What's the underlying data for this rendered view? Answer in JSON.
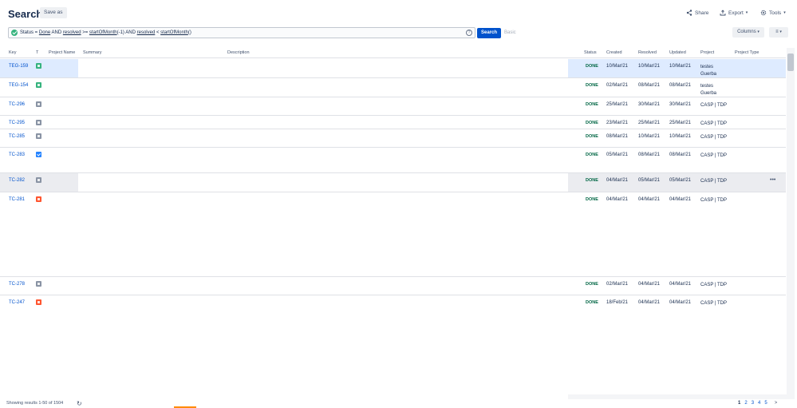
{
  "header": {
    "title": "Search",
    "save_as": "Save as",
    "share": "Share",
    "export": "Export",
    "tools": "Tools"
  },
  "query": {
    "p1": "Status = ",
    "status": "Done",
    "p2": " AND ",
    "resolved1": "resolved",
    "p3": " >= ",
    "fn1": "startOfMonth",
    "p4": "(-1) AND ",
    "resolved2": "resolved",
    "p5": " < ",
    "fn2": "startOfMonth",
    "p6": "()",
    "help": "?",
    "search_label": "Search",
    "basic_label": "Basic"
  },
  "toolbar": {
    "columns": "Columns",
    "menu": "≡"
  },
  "columns": {
    "key": "Key",
    "t": "T",
    "project_name": "Project Name",
    "summary": "Summary",
    "description": "Description",
    "status": "Status",
    "created": "Created",
    "resolved": "Resolved",
    "updated": "Updated",
    "project": "Project",
    "project_type": "Project Type"
  },
  "rows": [
    {
      "key": "TEG-159",
      "type": "story-icon",
      "status": "DONE",
      "created": "10/Mar/21",
      "resolved": "10/Mar/21",
      "updated": "10/Mar/21",
      "project": "testes Guerba"
    },
    {
      "key": "TEG-154",
      "type": "story-icon",
      "status": "DONE",
      "created": "02/Mar/21",
      "resolved": "08/Mar/21",
      "updated": "08/Mar/21",
      "project": "testes Guerba"
    },
    {
      "key": "TC-296",
      "type": "task-icon",
      "status": "DONE",
      "created": "25/Mar/21",
      "resolved": "30/Mar/21",
      "updated": "30/Mar/21",
      "project": "CASP | TDP"
    },
    {
      "key": "TC-295",
      "type": "task-icon",
      "status": "DONE",
      "created": "23/Mar/21",
      "resolved": "25/Mar/21",
      "updated": "25/Mar/21",
      "project": "CASP | TDP"
    },
    {
      "key": "TC-285",
      "type": "task-icon",
      "status": "DONE",
      "created": "08/Mar/21",
      "resolved": "10/Mar/21",
      "updated": "10/Mar/21",
      "project": "CASP | TDP"
    },
    {
      "key": "TC-283",
      "type": "check-icon",
      "status": "DONE",
      "created": "05/Mar/21",
      "resolved": "08/Mar/21",
      "updated": "08/Mar/21",
      "project": "CASP | TDP"
    },
    {
      "key": "TC-282",
      "type": "task-icon",
      "status": "DONE",
      "created": "04/Mar/21",
      "resolved": "05/Mar/21",
      "updated": "05/Mar/21",
      "project": "CASP | TDP",
      "more": "•••"
    },
    {
      "key": "TC-281",
      "type": "bug-icon",
      "status": "DONE",
      "created": "04/Mar/21",
      "resolved": "04/Mar/21",
      "updated": "04/Mar/21",
      "project": "CASP | TDP"
    },
    {
      "key": "TC-278",
      "type": "task-icon",
      "status": "DONE",
      "created": "02/Mar/21",
      "resolved": "04/Mar/21",
      "updated": "04/Mar/21",
      "project": "CASP | TDP"
    },
    {
      "key": "TC-247",
      "type": "bug-icon",
      "status": "DONE",
      "created": "18/Feb/21",
      "resolved": "04/Mar/21",
      "updated": "04/Mar/21",
      "project": "CASP | TDP"
    }
  ],
  "footer": {
    "showing": "Showing results 1-50 of 1504",
    "pages": [
      "1",
      "2",
      "3",
      "4",
      "5"
    ],
    "next": ">"
  }
}
